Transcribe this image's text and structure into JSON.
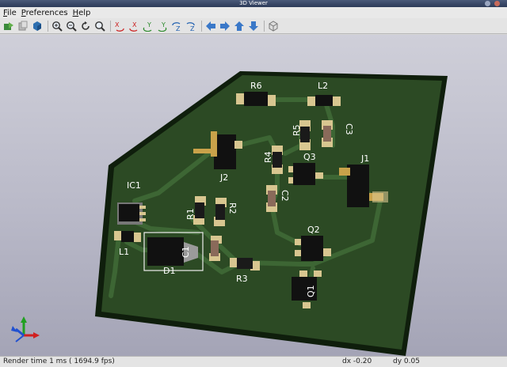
{
  "window": {
    "title": "3D Viewer"
  },
  "menu": [
    {
      "key": "F",
      "rest": "ile"
    },
    {
      "key": "P",
      "rest": "references"
    },
    {
      "key": "H",
      "rest": "elp"
    }
  ],
  "toolbar": {
    "icons": [
      "reload-icon",
      "copy-icon",
      "render-icon",
      "zoom-in-icon",
      "zoom-out-icon",
      "redraw-icon",
      "zoom-fit-icon",
      "rotate-x-cw-icon",
      "rotate-x-ccw-icon",
      "rotate-y-cw-icon",
      "rotate-y-ccw-icon",
      "rotate-z-cw-icon",
      "rotate-z-ccw-icon",
      "pan-left-icon",
      "pan-right-icon",
      "pan-up-icon",
      "pan-down-icon",
      "ortho-icon"
    ]
  },
  "board": {
    "labels": {
      "r6": "R6",
      "l2": "L2",
      "r5": "R5",
      "c3": "C3",
      "r4": "R4",
      "q3": "Q3",
      "j1": "J1",
      "j2": "J2",
      "c2": "C2",
      "ic1": "IC1",
      "r1": "R1",
      "r2": "R2",
      "l1": "L1",
      "c1": "C1",
      "d1": "D1",
      "r3": "R3",
      "q2": "Q2",
      "q1": "Q1"
    },
    "colors": {
      "pcb": "#2c4a24",
      "pcb_edge": "#0f1e0c",
      "track": "#3d6634",
      "pad": "#d8c690"
    }
  },
  "status": {
    "render": "Render time 1 ms ( 1694.9 fps)",
    "dx": "dx -0.20",
    "dy": "dy 0.05"
  }
}
